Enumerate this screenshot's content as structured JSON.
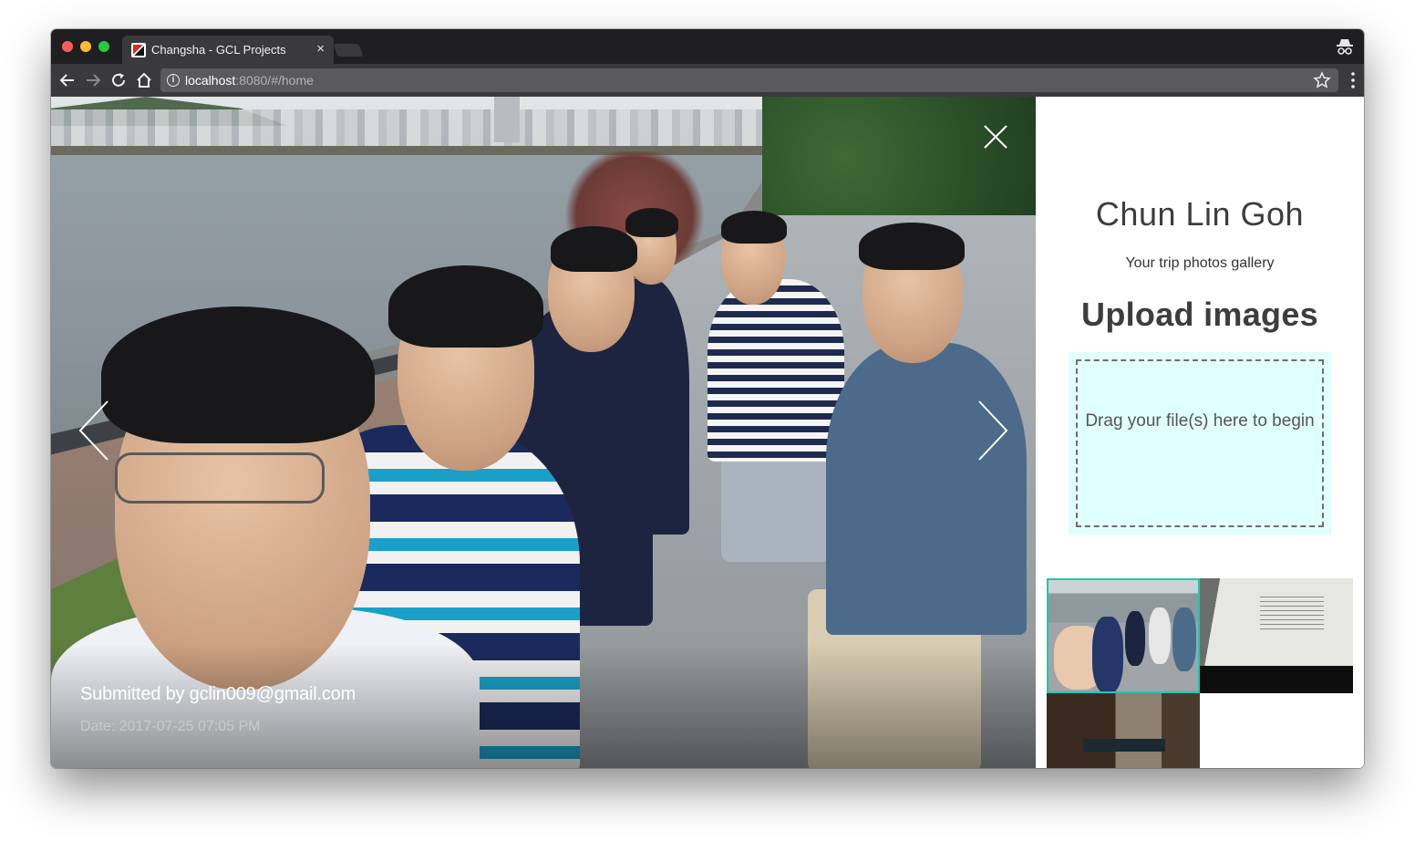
{
  "browser": {
    "tab_title": "Changsha - GCL Projects",
    "tab_close": "×",
    "url_host": "localhost",
    "url_rest": ":8080/#/home"
  },
  "lightbox": {
    "caption_title": "Submitted by gclin009@gmail.com",
    "caption_date": "Date: 2017-07-25 07:05 PM"
  },
  "sidebar": {
    "owner_name": "Chun Lin Goh",
    "subtitle": "Your trip photos gallery",
    "upload_heading": "Upload images",
    "dropzone_text": "Drag your file(s) here to begin"
  },
  "colors": {
    "dropzone_bg": "#e0ffff",
    "active_thumb_border": "#1fc8b2"
  }
}
